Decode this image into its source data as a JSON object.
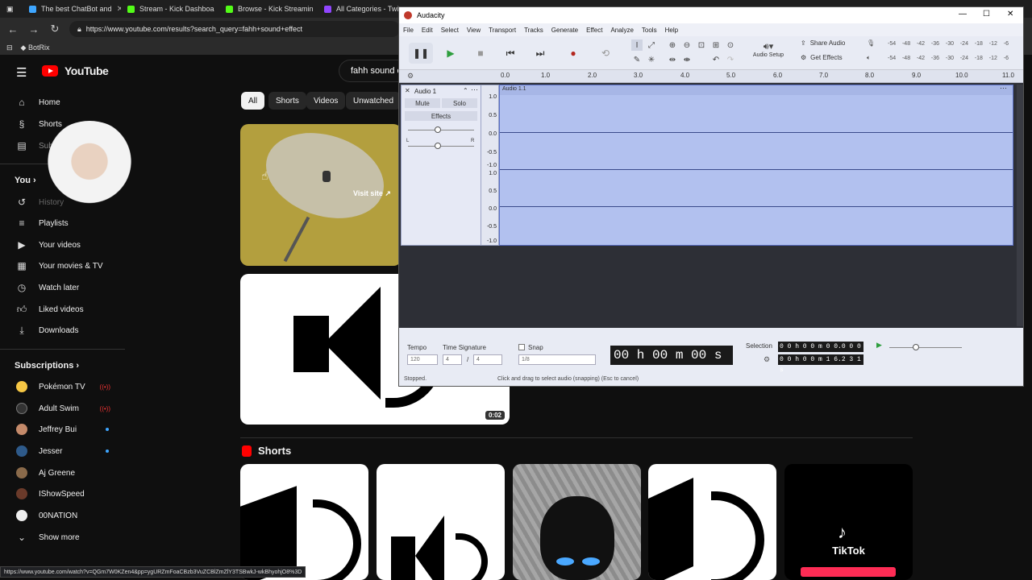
{
  "browser": {
    "tabs": [
      {
        "title": "The best ChatBot and",
        "color": "#3ea6ff"
      },
      {
        "title": "Stream - Kick Dashboa",
        "color": "#53fc18"
      },
      {
        "title": "Browse - Kick Streamin",
        "color": "#53fc18"
      },
      {
        "title": "All Categories - Twitc",
        "color": "#9146ff"
      }
    ],
    "url": "https://www.youtube.com/results?search_query=fahh+sound+effect",
    "bookmark": "BotRix",
    "status_url": "https://www.youtube.com/watch?v=QGm7W0KZen4&pp=ygURZmFoaCBzb3VuZCBlZmZlY3TSBwkJ-wkBhyohjO8%3D"
  },
  "youtube": {
    "logo": "YouTube",
    "search_value": "fahh sound e",
    "nav": [
      "Home",
      "Shorts",
      "Subscriptions"
    ],
    "you_label": "You",
    "you_items": [
      "History",
      "Playlists",
      "Your videos",
      "Your movies & TV",
      "Watch later",
      "Liked videos",
      "Downloads"
    ],
    "subs_label": "Subscriptions",
    "subscriptions": [
      {
        "name": "Pokémon TV",
        "badge": "live",
        "color": "#f6c744"
      },
      {
        "name": "Adult Swim",
        "badge": "live",
        "color": "#222"
      },
      {
        "name": "Jeffrey Bui",
        "badge": "dot",
        "color": "#c48a6a"
      },
      {
        "name": "Jesser",
        "badge": "dot",
        "color": "#2e5a8a"
      },
      {
        "name": "Aj Greene",
        "badge": "",
        "color": "#8a6a4a"
      },
      {
        "name": "IShowSpeed",
        "badge": "",
        "color": "#6a3a2a"
      },
      {
        "name": "00NATION",
        "badge": "",
        "color": "#eee"
      }
    ],
    "show_more": "Show more",
    "chips": [
      "All",
      "Shorts",
      "Videos",
      "Unwatched"
    ],
    "ad_cta": "Visit site",
    "video_duration": "0:02",
    "shorts_heading": "Shorts",
    "tiktok_label": "TikTok"
  },
  "audacity": {
    "title": "Audacity",
    "menu": [
      "File",
      "Edit",
      "Select",
      "View",
      "Transport",
      "Tracks",
      "Generate",
      "Effect",
      "Analyze",
      "Tools",
      "Help"
    ],
    "audio_setup": "Audio Setup",
    "share_audio": "Share Audio",
    "get_effects": "Get Effects",
    "meter_ticks": [
      "-54",
      "-48",
      "-42",
      "-36",
      "-30",
      "-24",
      "-18",
      "-12",
      "-6"
    ],
    "ruler": [
      "0.0",
      "1.0",
      "2.0",
      "3.0",
      "4.0",
      "5.0",
      "6.0",
      "7.0",
      "8.0",
      "9.0",
      "10.0",
      "11.0"
    ],
    "track_name": "Audio 1",
    "clip_name": "Audio 1.1",
    "mute": "Mute",
    "solo": "Solo",
    "effects": "Effects",
    "pan_l": "L",
    "pan_r": "R",
    "scale": [
      "1.0",
      "0.5",
      "0.0",
      "-0.5",
      "-1.0",
      "1.0",
      "0.5",
      "0.0",
      "-0.5",
      "-1.0"
    ],
    "tempo_label": "Tempo",
    "tempo": "120",
    "timesig_label": "Time Signature",
    "timesig_num": "4",
    "timesig_den": "4",
    "snap_label": "Snap",
    "snap_value": "1/8",
    "time_display": "00 h 00 m 00 s",
    "selection_label": "Selection",
    "sel_start": "0 0 h 0 0 m 0 0.0 0 0 s",
    "sel_end": "0 0 h 0 0 m 1 6.2 3 1 s",
    "status_left": "Stopped.",
    "status_hint": "Click and drag to select audio (snapping) (Esc to cancel)"
  }
}
